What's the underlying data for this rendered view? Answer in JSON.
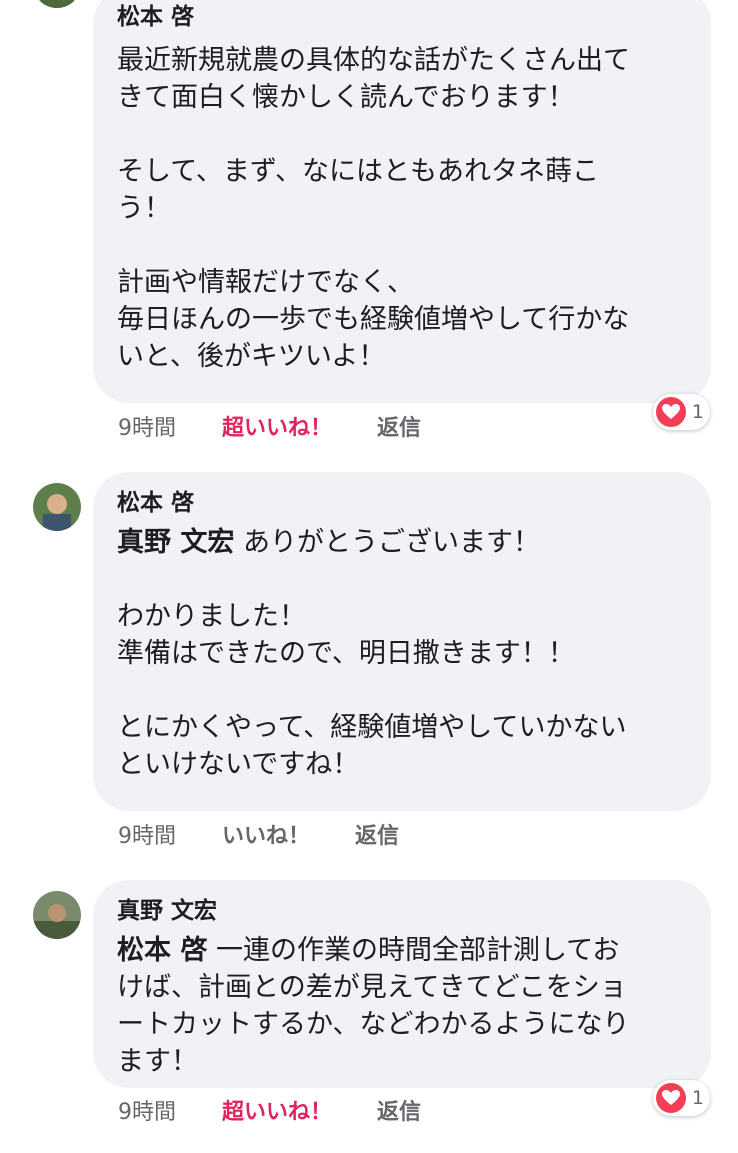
{
  "comments": [
    {
      "author": "松本 啓",
      "paragraphs": [
        "最近新規就農の具体的な話がたくさん出て\nきて面白く懐かしく読んでおります！",
        "そして、まず、なにはともあれタネ蒔こ\nう！",
        "計画や情報だけでなく、\n毎日ほんの一歩でも経験値増やして行かな\nいと、後がキツいよ！"
      ],
      "time": "9時間",
      "reaction_label": "超いいね！",
      "reply_label": "返信",
      "reaction_count": "1"
    },
    {
      "author": "松本 啓",
      "mention": "真野 文宏",
      "first_line": " ありがとうございます！",
      "paragraphs": [
        "わかりました！\n準備はできたので、明日撒きます！！",
        "とにかくやって、経験値増やしていかない\nといけないですね！"
      ],
      "time": "9時間",
      "reaction_label": "いいね！",
      "reply_label": "返信"
    },
    {
      "author": "真野 文宏",
      "mention": "松本 啓",
      "first_line": " 一連の作業の時間全部計測してお\nけば、計画との差が見えてきてどこをショ\nートカットするか、などわかるようになり\nます！",
      "time": "9時間",
      "reaction_label": "超いいね！",
      "reply_label": "返信",
      "reaction_count": "1"
    }
  ],
  "colors": {
    "love": "#e0245e",
    "bubble": "#f0f2f5",
    "meta": "#65676b"
  },
  "icons": {
    "reaction": "heart-icon"
  }
}
